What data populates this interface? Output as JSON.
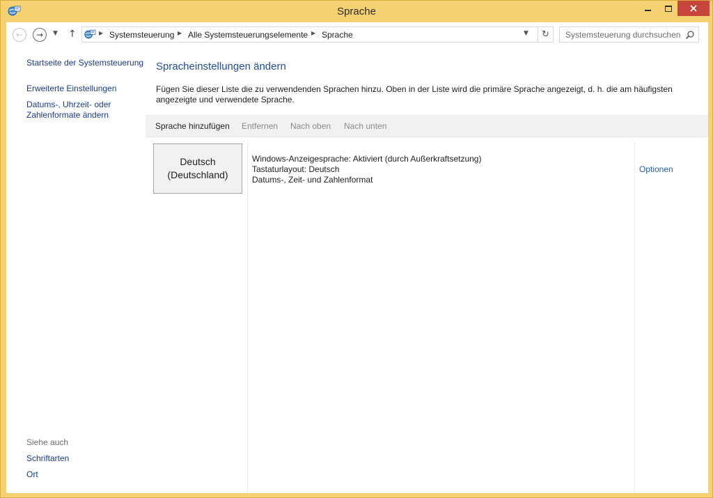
{
  "window": {
    "title": "Sprache"
  },
  "nav": {
    "breadcrumbs": [
      "Systemsteuerung",
      "Alle Systemsteuerungselemente",
      "Sprache"
    ],
    "search_placeholder": "Systemsteuerung durchsuchen"
  },
  "sidebar": {
    "links": [
      "Startseite der Systemsteuerung",
      "Erweiterte Einstellungen",
      "Datums-, Uhrzeit- oder",
      "Zahlenformate ändern"
    ],
    "see_also_heading": "Siehe auch",
    "see_also_links": [
      "Schriftarten",
      "Ort"
    ]
  },
  "main": {
    "title": "Spracheinstellungen ändern",
    "description_line1": "Fügen Sie dieser Liste die zu verwendenden Sprachen hinzu. Oben in der Liste wird die primäre Sprache angezeigt, d. h. die am häufigsten",
    "description_line2": "angezeigte und verwendete Sprache.",
    "toolbar": {
      "add": "Sprache hinzufügen",
      "remove": "Entfernen",
      "up": "Nach oben",
      "down": "Nach unten"
    },
    "languages": [
      {
        "name_line1": "Deutsch",
        "name_line2": "(Deutschland)",
        "info": [
          "Windows-Anzeigesprache: Aktiviert (durch Außerkraftsetzung)",
          "Tastaturlayout: Deutsch",
          "Datums-, Zeit- und Zahlenformat"
        ],
        "options": "Optionen"
      }
    ]
  },
  "colors": {
    "frame": "#f5d171",
    "close_button": "#c7453a",
    "link": "#1a3a8e",
    "heading": "#1f4ea1"
  }
}
